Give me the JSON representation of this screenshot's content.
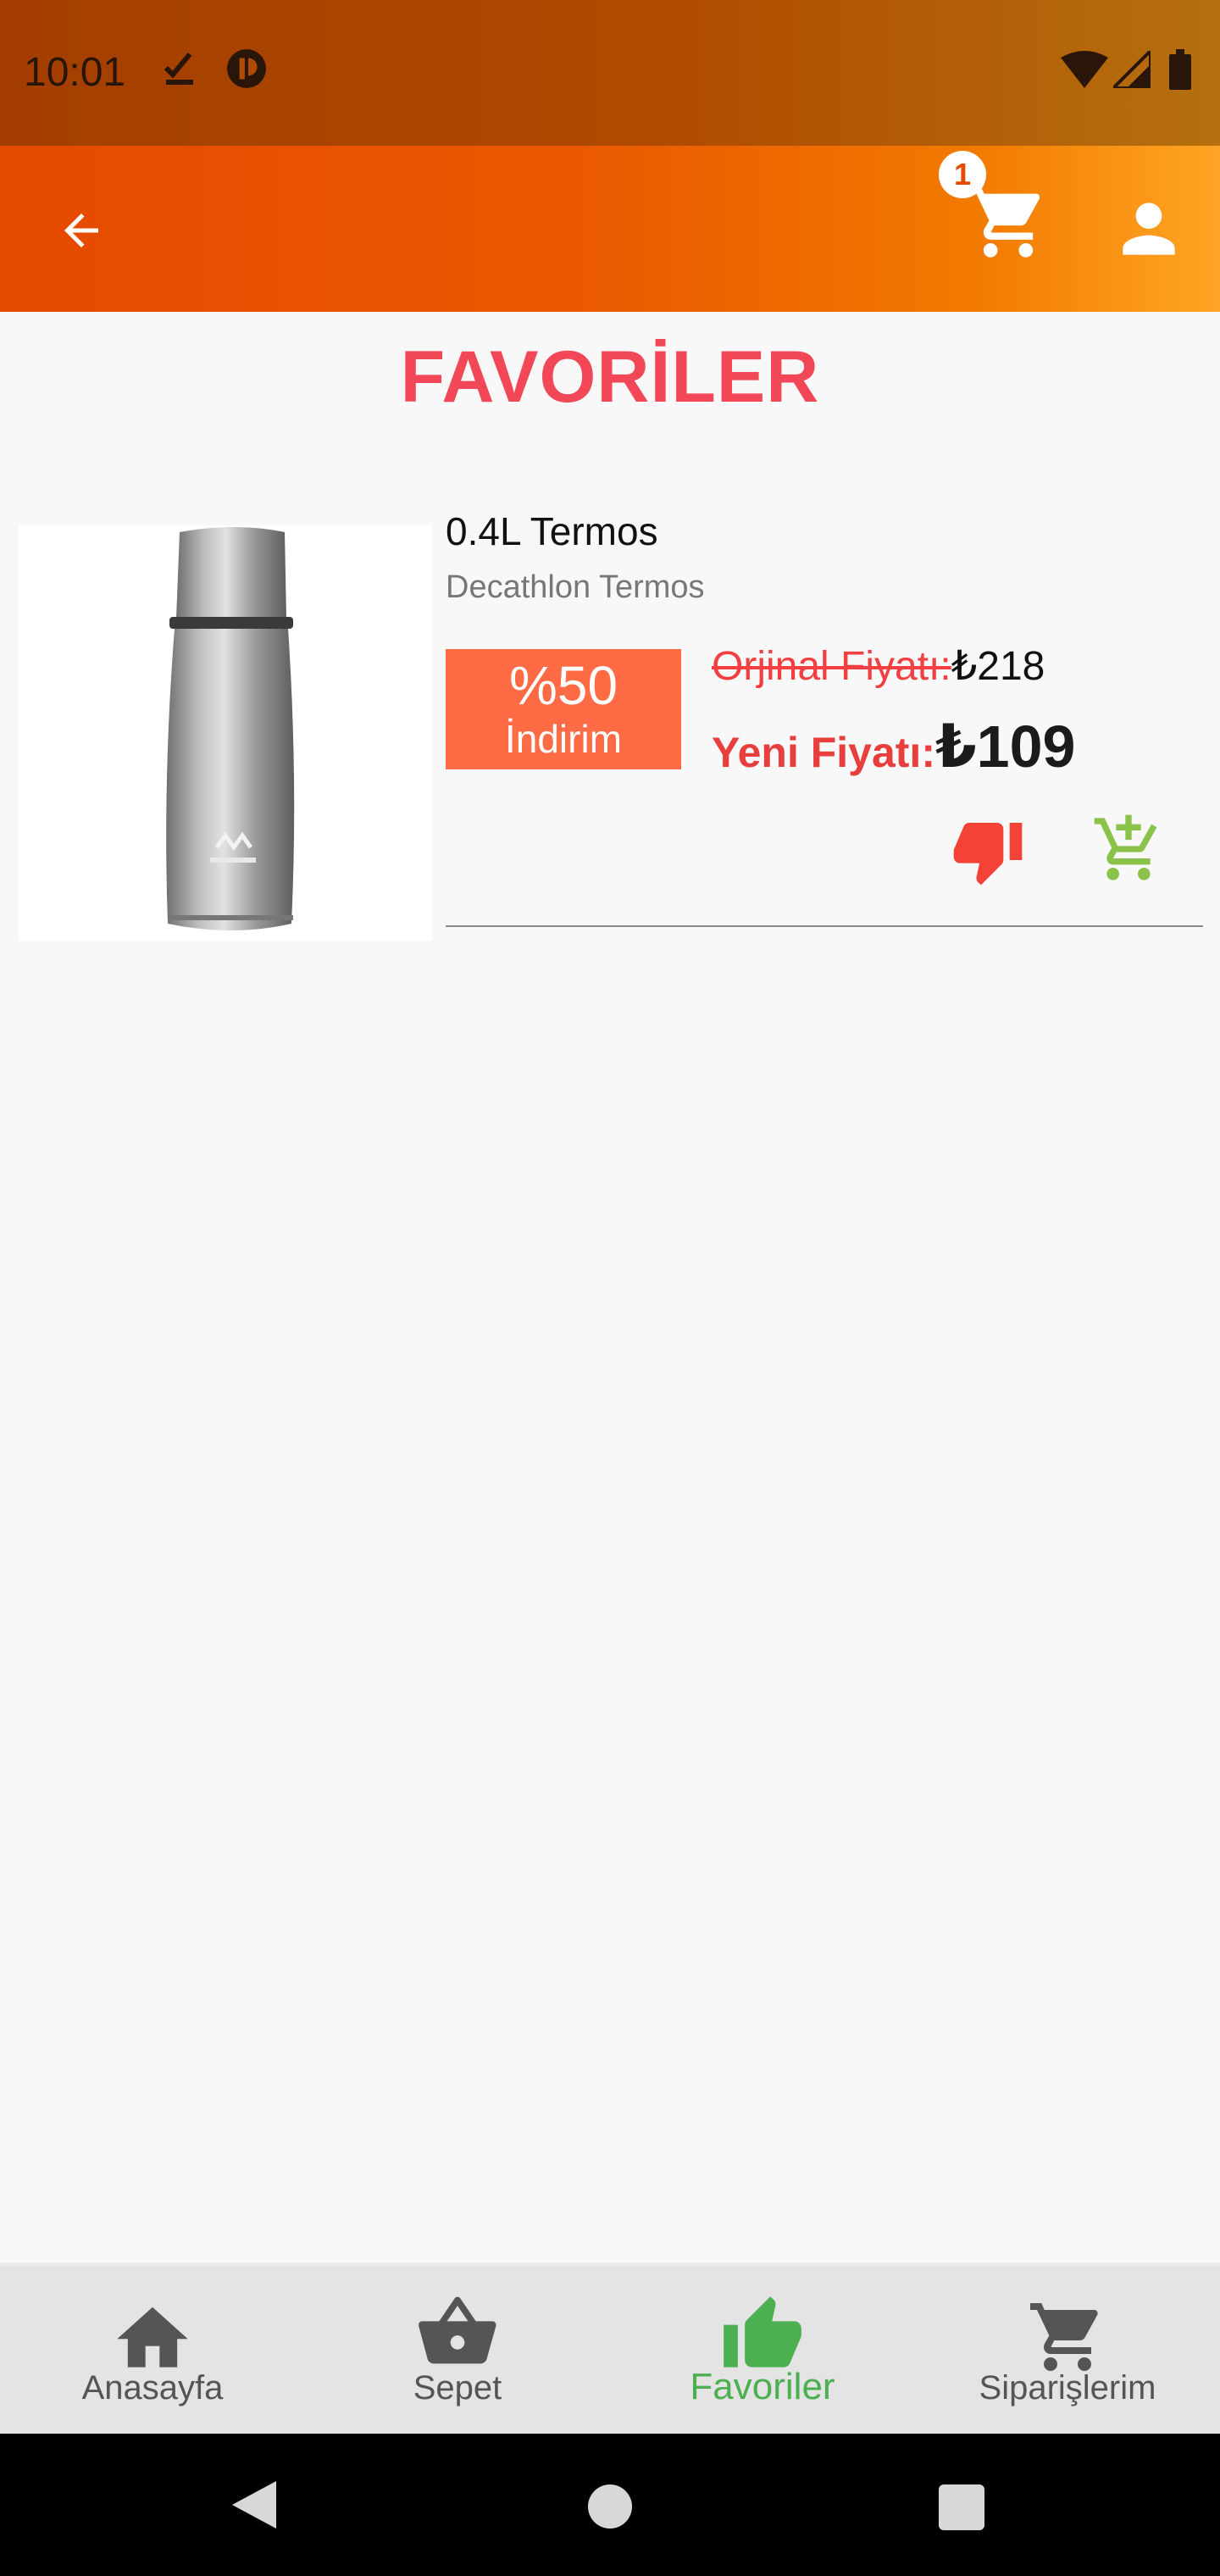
{
  "status_bar": {
    "time": "10:01"
  },
  "header": {
    "cart_count": "1"
  },
  "page": {
    "title": "FAVORİLER"
  },
  "favorites": [
    {
      "name": "0.4L Termos",
      "brand": "Decathlon Termos",
      "discount_percent": "%50",
      "discount_label": "İndirim",
      "original_price_label": "Orjinal Fiyatı:",
      "original_price": "₺218",
      "new_price_label": "Yeni Fiyatı:",
      "new_price": "₺109"
    }
  ],
  "bottom_nav": [
    {
      "label": "Anasayfa",
      "icon": "home-icon",
      "active": false
    },
    {
      "label": "Sepet",
      "icon": "basket-icon",
      "active": false
    },
    {
      "label": "Favoriler",
      "icon": "thumb-up-icon",
      "active": true
    },
    {
      "label": "Siparişlerim",
      "icon": "cart-icon",
      "active": false
    }
  ],
  "colors": {
    "title": "#f24757",
    "discount_bg": "#ff6b45",
    "active_nav": "#4caf50",
    "dislike": "#f44336",
    "add_cart": "#8bc34a"
  }
}
